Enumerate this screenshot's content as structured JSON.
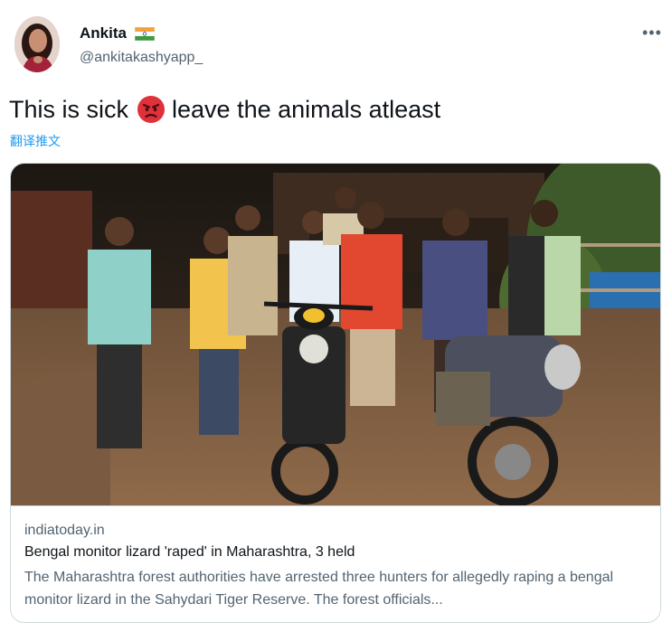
{
  "author": {
    "display_name": "Ankita",
    "handle": "@ankitakashyapp_",
    "flag_icon": "india-flag-icon",
    "avatar_icon": "user-avatar"
  },
  "more_icon_glyph": "•••",
  "tweet": {
    "text_before": "This is sick",
    "emoji_icon": "angry-face-icon",
    "text_after": "leave the animals atleast",
    "translate_label": "翻译推文"
  },
  "link_card": {
    "domain": "indiatoday.in",
    "title": "Bengal monitor lizard 'raped' in Maharashtra, 3 held",
    "description": "The Maharashtra forest authorities have arrested three hunters for allegedly raping a bengal monitor lizard in the Sahydari Tiger Reserve. The forest officials..."
  },
  "colors": {
    "text_primary": "#0f1419",
    "text_secondary": "#536471",
    "link_blue": "#1d9bf0",
    "border": "#cfd9de",
    "emoji_red": "#e0303a"
  }
}
